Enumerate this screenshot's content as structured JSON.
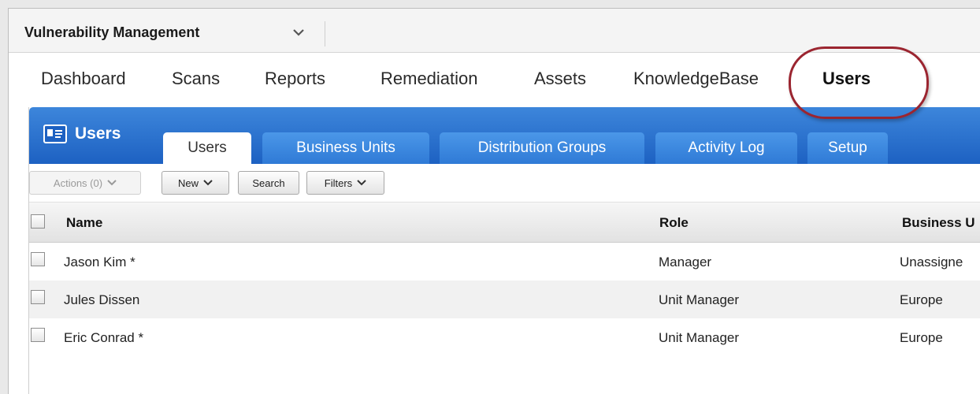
{
  "module": {
    "title": "Vulnerability Management"
  },
  "nav": {
    "items": [
      {
        "label": "Dashboard"
      },
      {
        "label": "Scans"
      },
      {
        "label": "Reports"
      },
      {
        "label": "Remediation"
      },
      {
        "label": "Assets"
      },
      {
        "label": "KnowledgeBase"
      },
      {
        "label": "Users",
        "active": true
      }
    ]
  },
  "section": {
    "label": "Users",
    "tabs": [
      {
        "label": "Users",
        "active": true
      },
      {
        "label": "Business Units"
      },
      {
        "label": "Distribution Groups"
      },
      {
        "label": "Activity Log"
      },
      {
        "label": "Setup"
      }
    ]
  },
  "toolbar": {
    "actions_label": "Actions (0)",
    "new_label": "New",
    "search_label": "Search",
    "filters_label": "Filters"
  },
  "table": {
    "columns": [
      "Name",
      "Role",
      "Business U"
    ],
    "rows": [
      {
        "name": "Jason Kim *",
        "role": "Manager",
        "business_unit": "Unassigne"
      },
      {
        "name": "Jules Dissen",
        "role": "Unit Manager",
        "business_unit": "Europe"
      },
      {
        "name": "Eric Conrad *",
        "role": "Unit Manager",
        "business_unit": "Europe"
      }
    ]
  },
  "colors": {
    "accent_blue": "#1d61c2",
    "highlight_ring": "#9b2530"
  }
}
